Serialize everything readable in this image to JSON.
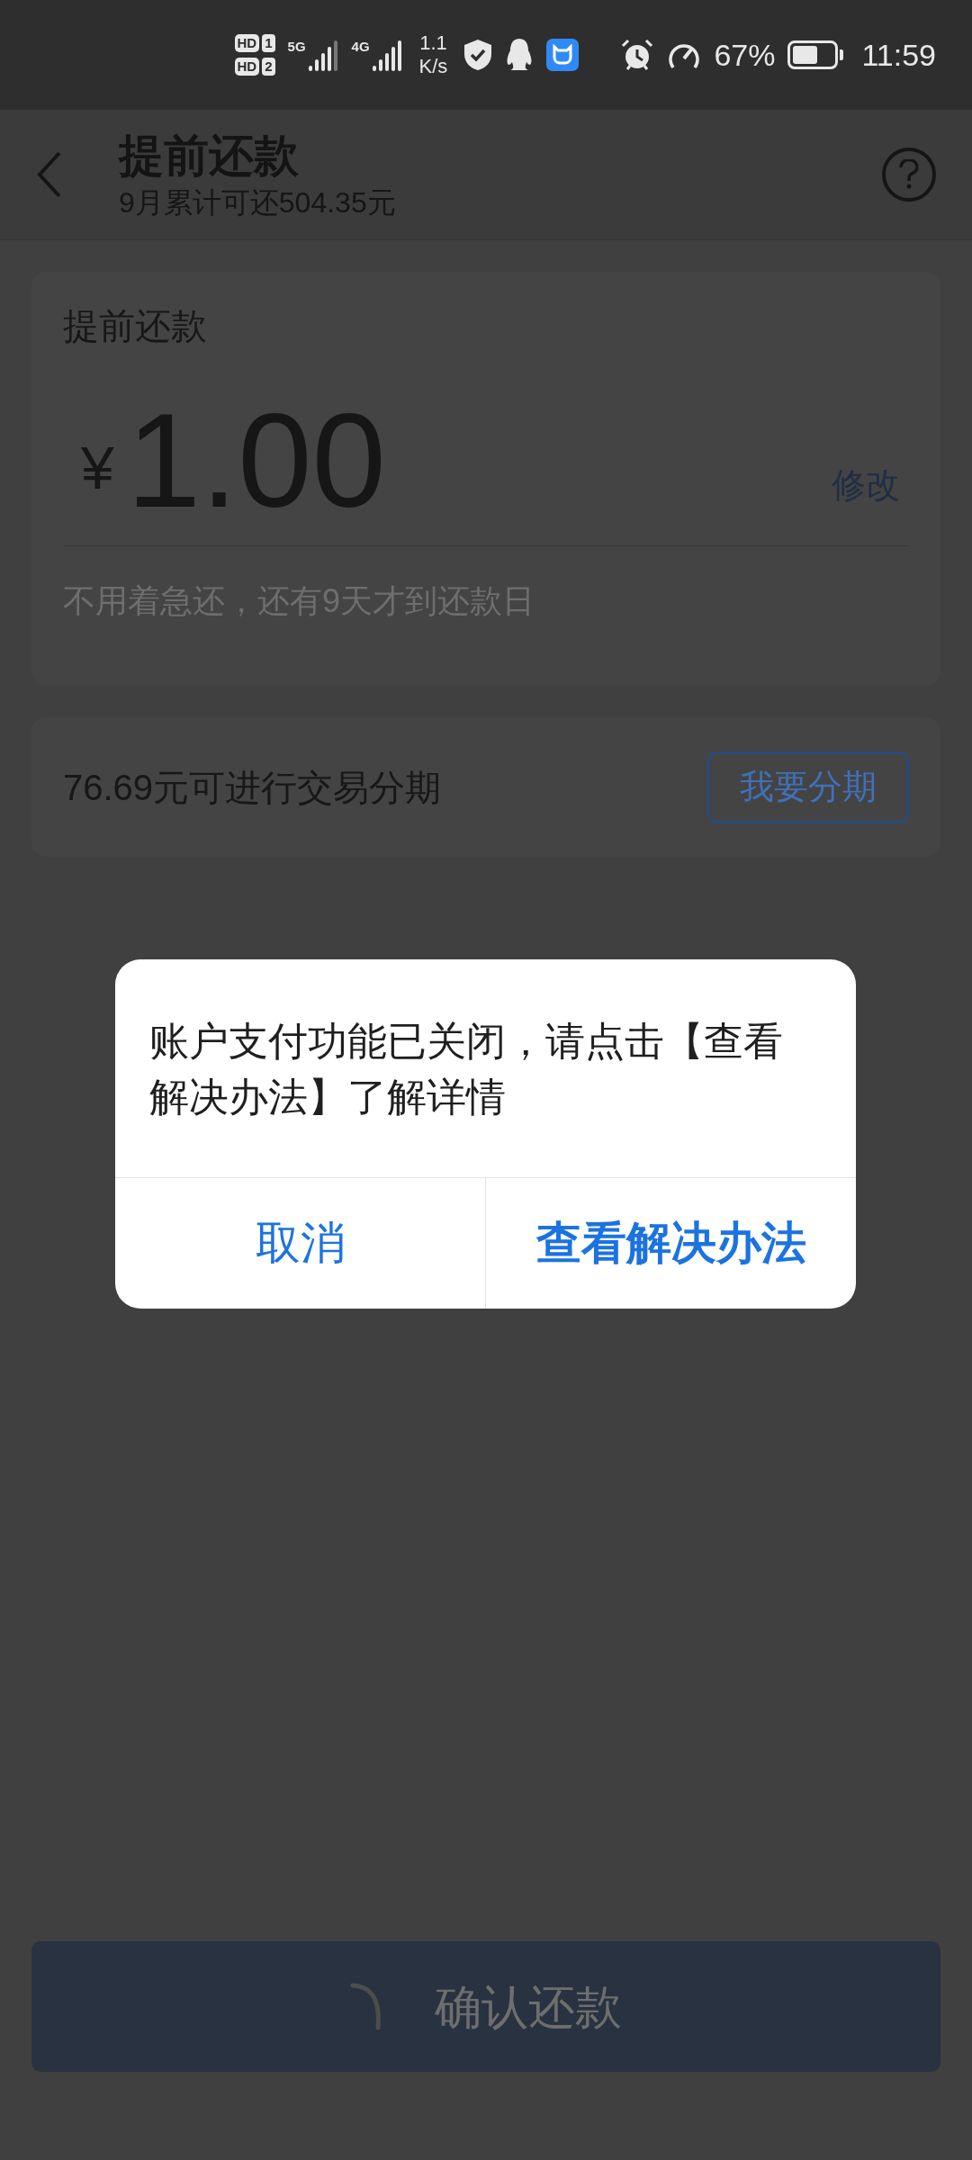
{
  "status_bar": {
    "sim_labels": [
      {
        "tag": "HD",
        "slot": "1"
      },
      {
        "tag": "HD",
        "slot": "2"
      }
    ],
    "networks": [
      "5G",
      "4G"
    ],
    "speed": [
      "1.1",
      "K/s"
    ],
    "battery": "67%",
    "time": "11:59"
  },
  "header": {
    "title": "提前还款",
    "subtitle": "9月累计可还504.35元"
  },
  "amount_card": {
    "title": "提前还款",
    "currency": "¥",
    "amount": "1.00",
    "edit": "修改",
    "hint": "不用着急还，还有9天才到还款日"
  },
  "installment_card": {
    "text": "76.69元可进行交易分期",
    "button": "我要分期"
  },
  "confirm_button": {
    "label": "确认还款",
    "loading": true
  },
  "dialog": {
    "message": "账户支付功能已关闭，请点击【查看解决办法】了解详情",
    "buttons": [
      {
        "label": "取消",
        "primary": false
      },
      {
        "label": "查看解决办法",
        "primary": true
      }
    ]
  }
}
